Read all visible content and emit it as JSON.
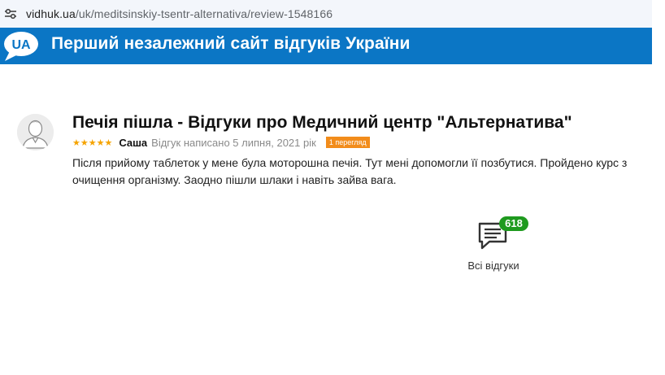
{
  "browser": {
    "url_host": "vidhuk.ua",
    "url_path": "/uk/meditsinskiy-tsentr-alternativa/review-1548166",
    "icons": [
      "site-settings-icon"
    ]
  },
  "header": {
    "logo_text": "UA",
    "title": "Перший незалежний сайт відгуків України",
    "color": "#0b76c5"
  },
  "review": {
    "title": "Печія пішла - Відгуки про Медичний центр \"Альтернатива\"",
    "stars": "★★★★★",
    "author": "Саша",
    "date_text": "Відгук написано 5 липня, 2021 рік",
    "views_badge": "1 перегляд",
    "body": "Після прийому таблеток у мене була моторошна печія. Тут мені допомогли її позбутися. Пройдено курс з очищення організму. Заодно пішли шлаки і навіть зайва вага.",
    "star_color": "#f5a300",
    "badge_color": "#f28c1b"
  },
  "all_reviews": {
    "count": "618",
    "label": "Всі відгуки",
    "badge_color": "#1f9a1f"
  }
}
